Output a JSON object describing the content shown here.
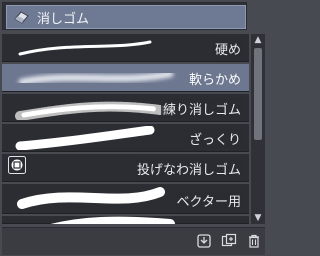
{
  "header": {
    "title": "消しゴム",
    "icon": "eraser-icon"
  },
  "brushes": [
    {
      "name": "硬め",
      "selected": false,
      "style": "hard"
    },
    {
      "name": "軟らかめ",
      "selected": true,
      "style": "soft"
    },
    {
      "name": "練り消しゴム",
      "selected": false,
      "style": "kneaded"
    },
    {
      "name": "ざっくり",
      "selected": false,
      "style": "rough"
    },
    {
      "name": "投げなわ消しゴム",
      "selected": false,
      "style": "lasso"
    },
    {
      "name": "ベクター用",
      "selected": false,
      "style": "vector"
    }
  ],
  "footer": {
    "icons": [
      "download-icon",
      "add-copy-icon",
      "trash-icon"
    ]
  },
  "colors": {
    "selected_bg": "#6d7790",
    "row_bg": "#2b2d32",
    "stroke": "#ffffff"
  }
}
